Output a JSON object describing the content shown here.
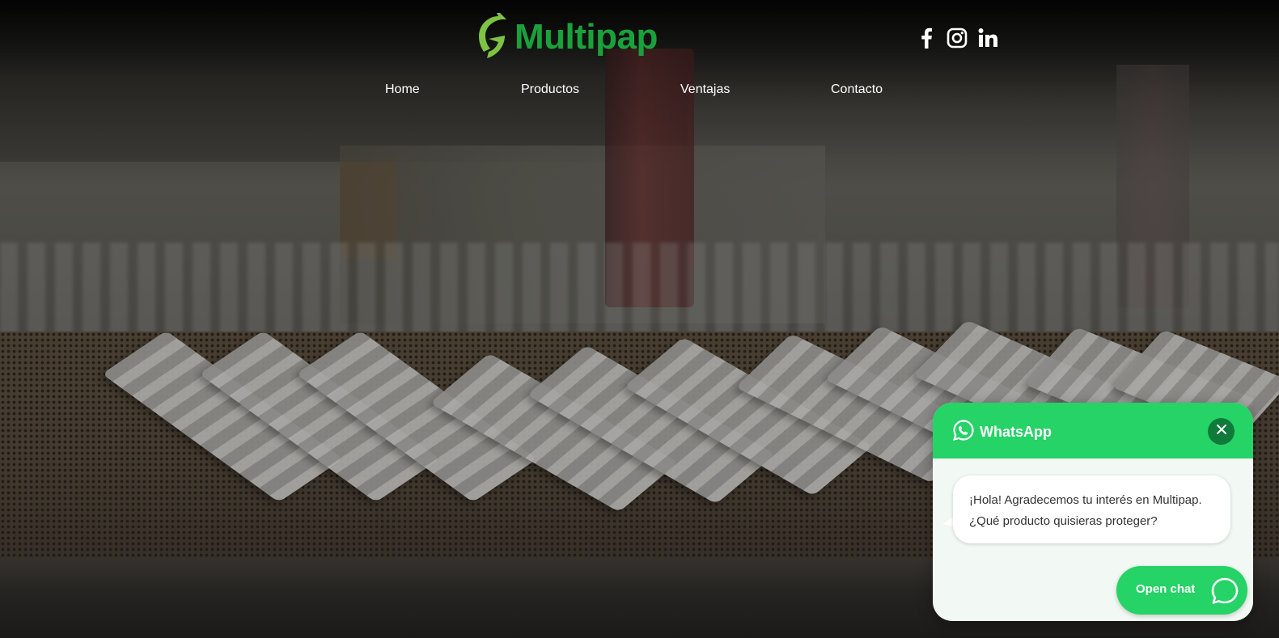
{
  "brand": {
    "name": "Multipap",
    "primary_color": "#1aa23a",
    "leaf_color": "#7dc242"
  },
  "social": [
    {
      "name": "facebook-icon"
    },
    {
      "name": "instagram-icon"
    },
    {
      "name": "linkedin-icon"
    }
  ],
  "nav": {
    "items": [
      {
        "label": "Home"
      },
      {
        "label": "Productos"
      },
      {
        "label": "Ventajas"
      },
      {
        "label": "Contacto"
      }
    ]
  },
  "whatsapp": {
    "title": "WhatsApp",
    "header_color": "#25d366",
    "message_line1": "¡Hola! Agradecemos tu interés en Multipap.",
    "message_line2": "¿Qué producto quisieras proteger?",
    "open_chat_label": "Open chat",
    "close_icon": "close-icon"
  }
}
